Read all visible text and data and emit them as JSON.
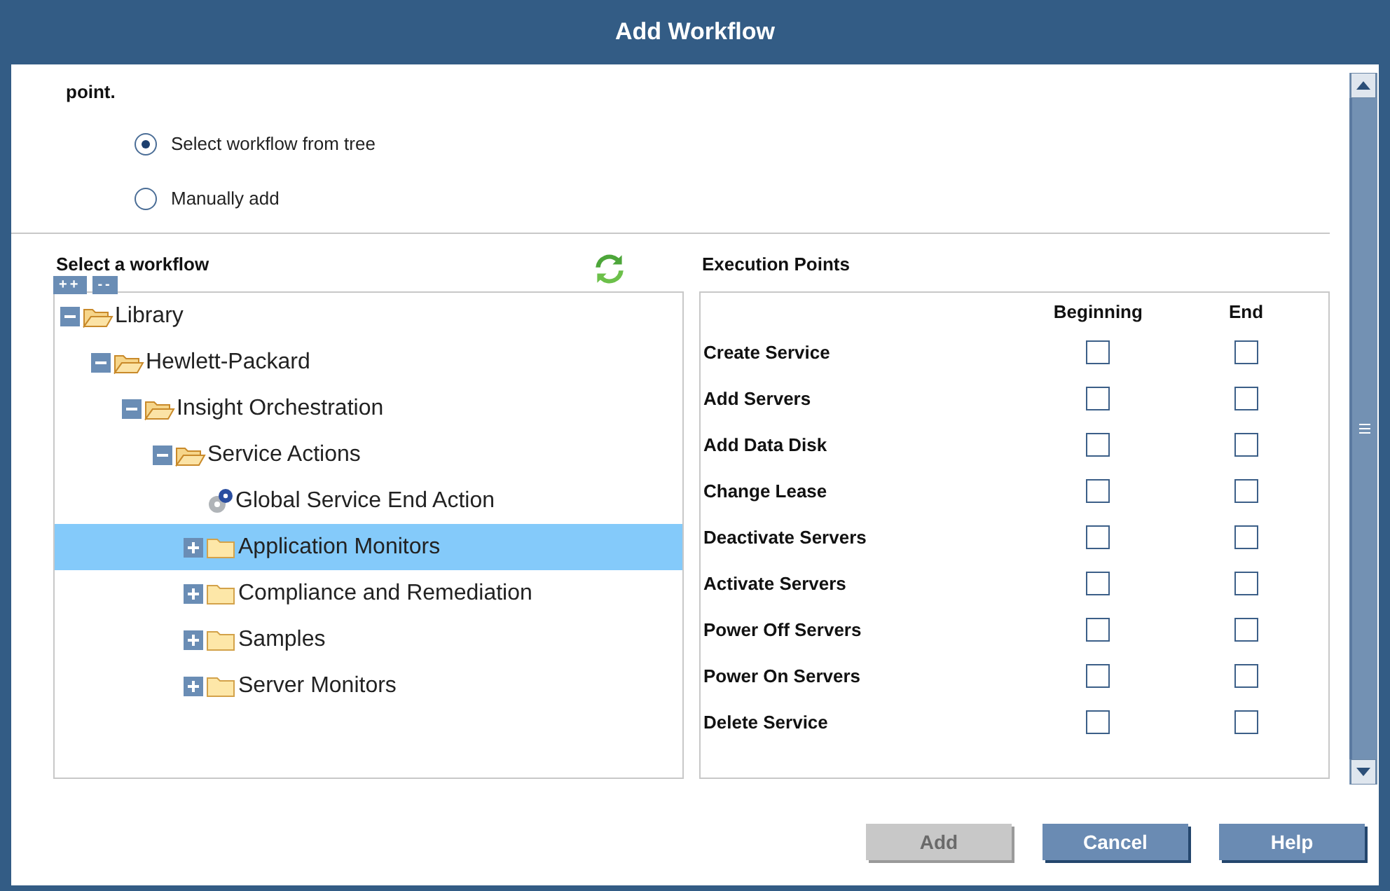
{
  "window": {
    "title": "Add Workflow"
  },
  "intro": {
    "text": "point."
  },
  "mode_options": [
    {
      "label": "Select workflow from tree",
      "selected": true
    },
    {
      "label": "Manually add",
      "selected": false
    }
  ],
  "workflow_panel": {
    "title": "Select a workflow",
    "expand_all": "++",
    "collapse_all": "--",
    "tree": [
      {
        "label": "Library",
        "kind": "folder",
        "expanded": true,
        "selected": false,
        "children": [
          {
            "label": "Hewlett-Packard",
            "kind": "folder",
            "expanded": true,
            "selected": false,
            "children": [
              {
                "label": "Insight Orchestration",
                "kind": "folder",
                "expanded": true,
                "selected": false,
                "children": [
                  {
                    "label": "Service Actions",
                    "kind": "folder",
                    "expanded": true,
                    "selected": false,
                    "children": [
                      {
                        "label": "Global Service End Action",
                        "kind": "action",
                        "selected": false
                      },
                      {
                        "label": "Application Monitors",
                        "kind": "folder",
                        "expanded": false,
                        "selected": true
                      },
                      {
                        "label": "Compliance and Remediation",
                        "kind": "folder",
                        "expanded": false,
                        "selected": false
                      },
                      {
                        "label": "Samples",
                        "kind": "folder",
                        "expanded": false,
                        "selected": false
                      },
                      {
                        "label": "Server Monitors",
                        "kind": "folder",
                        "expanded": false,
                        "selected": false
                      }
                    ]
                  }
                ]
              }
            ]
          }
        ]
      }
    ]
  },
  "execution_points": {
    "title": "Execution Points",
    "columns": [
      "Beginning",
      "End"
    ],
    "rows": [
      {
        "name": "Create Service",
        "beginning": false,
        "end": false
      },
      {
        "name": "Add Servers",
        "beginning": false,
        "end": false
      },
      {
        "name": "Add Data Disk",
        "beginning": false,
        "end": false
      },
      {
        "name": "Change Lease",
        "beginning": false,
        "end": false
      },
      {
        "name": "Deactivate Servers",
        "beginning": false,
        "end": false
      },
      {
        "name": "Activate Servers",
        "beginning": false,
        "end": false
      },
      {
        "name": "Power Off Servers",
        "beginning": false,
        "end": false
      },
      {
        "name": "Power On Servers",
        "beginning": false,
        "end": false
      },
      {
        "name": "Delete Service",
        "beginning": false,
        "end": false
      }
    ]
  },
  "buttons": [
    {
      "label": "Add",
      "disabled": true
    },
    {
      "label": "Cancel",
      "disabled": false
    },
    {
      "label": "Help",
      "disabled": false
    }
  ]
}
